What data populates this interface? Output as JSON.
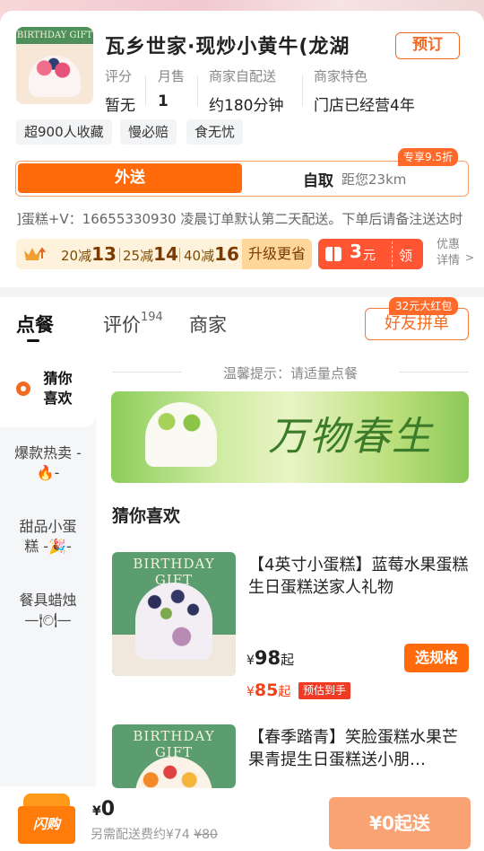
{
  "store": {
    "logo_caption": "BIRTHDAY GIFT",
    "title": "瓦乡世家·现炒小黄牛(龙湖",
    "book_label": "预订",
    "stats": [
      {
        "label": "评分",
        "value": "暂无"
      },
      {
        "label": "月售",
        "value": "1"
      },
      {
        "label": "商家自配送",
        "value": "约180分钟"
      },
      {
        "label": "商家特色",
        "value": "门店已经营4年"
      }
    ],
    "tags": [
      "超900人收藏",
      "慢必赔",
      "食无忧"
    ]
  },
  "delivery": {
    "active": "外送",
    "other": "自取",
    "distance": "距您23km",
    "badge": "专享9.5折"
  },
  "notice": "]蛋糕+V：16655330930 凌晨订单默认第二天配送。下单后请备注送达时",
  "promo": {
    "items": [
      {
        "prefix": "20减",
        "value": "13"
      },
      {
        "prefix": "25减",
        "value": "14"
      },
      {
        "prefix": "40减",
        "value": "16"
      }
    ],
    "upgrade": "升级更省",
    "coupon_amount": "3",
    "coupon_unit": "元",
    "coupon_action": "领",
    "more_line1": "优惠",
    "more_line2": "详情",
    "more_arrow": ">"
  },
  "tabs": {
    "order": "点餐",
    "reviews": "评价",
    "reviews_count": "194",
    "merchant": "商家",
    "group_label": "好友拼单",
    "group_badge": "32元大红包"
  },
  "sidebar": {
    "items": [
      {
        "label1": "猜你",
        "label2": "喜欢"
      },
      {
        "label1": "爆款热卖 -",
        "label2": "🔥-"
      },
      {
        "label1": "甜品小蛋",
        "label2": "糕 -🎉-"
      },
      {
        "label1": "餐具蜡烛",
        "label2": "—🍽—"
      }
    ]
  },
  "content": {
    "tip": "温馨提示：请适量点餐",
    "banner_text": "万物春生",
    "section": "猜你喜欢",
    "products": [
      {
        "caption": "BIRTHDAY GIFT",
        "name": "【4英寸小蛋糕】蓝莓水果蛋糕生日蛋糕送家人礼物",
        "price_symbol": "¥",
        "price": "98",
        "price_suffix": "起",
        "sale_price": "85",
        "sale_suffix": "起",
        "estimate": "预估到手",
        "action": "选规格"
      },
      {
        "caption": "BIRTHDAY GIFT",
        "name": "【春季踏青】笑脸蛋糕水果芒果青提生日蛋糕送小朋…"
      }
    ]
  },
  "cart": {
    "bag_label": "闪购",
    "currency": "¥",
    "total": "0",
    "need_text": "另需配送费约¥74",
    "original_fee": "¥80",
    "checkout": "¥0起送"
  }
}
